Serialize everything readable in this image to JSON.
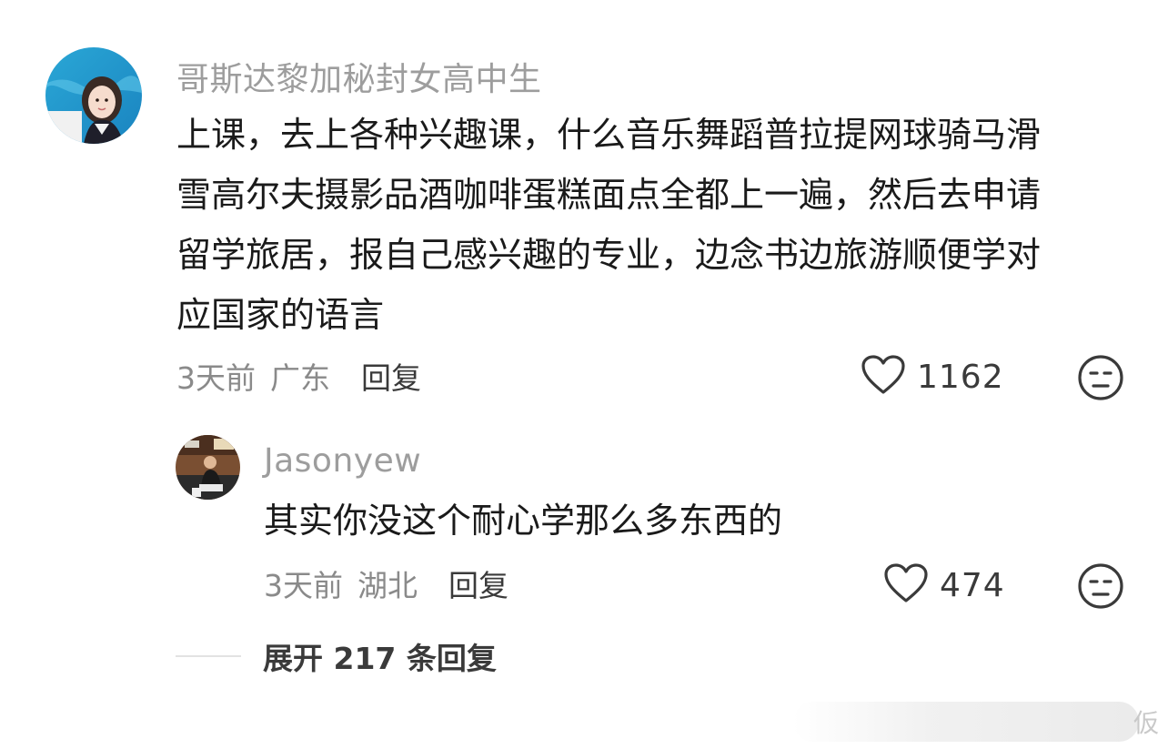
{
  "comments": [
    {
      "username": "哥斯达黎加秘封女高中生",
      "lines": [
        "上课，去上各种兴趣课，什么音乐舞蹈普拉提网球骑马滑",
        "雪高尔夫摄影品酒咖啡蛋糕面点全都上一遍，然后去申请",
        "留学旅居，报自己感兴趣的专业，边念书边旅游顺便学对",
        "应国家的语言"
      ],
      "time": "3天前",
      "location": "广东",
      "reply_label": "回复",
      "likes": "1162"
    },
    {
      "username": "Jasonyew",
      "lines": [
        "其实你没这个耐心学那么多东西的"
      ],
      "time": "3天前",
      "location": "湖北",
      "reply_label": "回复",
      "likes": "474"
    }
  ],
  "expand_replies": {
    "label": "展开 217 条回复"
  },
  "watermark": {
    "text": "仮"
  },
  "icons": {
    "like": "heart-outline-icon",
    "dislike": "unamused-face-icon"
  },
  "colors": {
    "username": "#9d9d9d",
    "body_text": "#1a1a1a",
    "meta": "#8a8a8a",
    "icon": "#3a3a3a"
  }
}
